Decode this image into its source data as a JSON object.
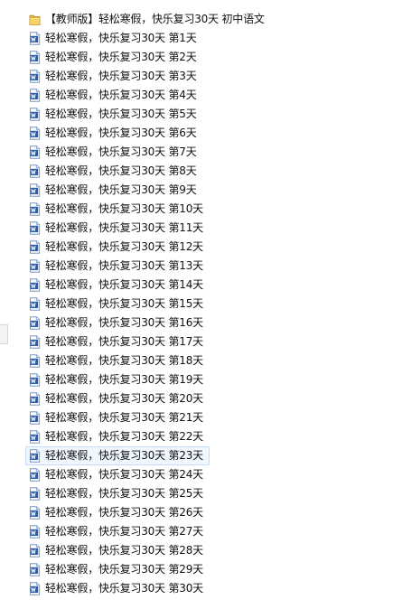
{
  "folder": {
    "name": "【教师版】轻松寒假，快乐复习30天 初中语文",
    "icon": "folder-icon"
  },
  "files": [
    {
      "name": "轻松寒假，快乐复习30天 第1天",
      "icon": "word-document-icon"
    },
    {
      "name": "轻松寒假，快乐复习30天 第2天",
      "icon": "word-document-icon"
    },
    {
      "name": "轻松寒假，快乐复习30天 第3天",
      "icon": "word-document-icon"
    },
    {
      "name": "轻松寒假，快乐复习30天 第4天",
      "icon": "word-document-icon"
    },
    {
      "name": "轻松寒假，快乐复习30天 第5天",
      "icon": "word-document-icon"
    },
    {
      "name": "轻松寒假，快乐复习30天 第6天",
      "icon": "word-document-icon"
    },
    {
      "name": "轻松寒假，快乐复习30天 第7天",
      "icon": "word-document-icon"
    },
    {
      "name": "轻松寒假，快乐复习30天 第8天",
      "icon": "word-document-icon"
    },
    {
      "name": "轻松寒假，快乐复习30天 第9天",
      "icon": "word-document-icon"
    },
    {
      "name": "轻松寒假，快乐复习30天 第10天",
      "icon": "word-document-icon"
    },
    {
      "name": "轻松寒假，快乐复习30天 第11天",
      "icon": "word-document-icon"
    },
    {
      "name": "轻松寒假，快乐复习30天 第12天",
      "icon": "word-document-icon"
    },
    {
      "name": "轻松寒假，快乐复习30天 第13天",
      "icon": "word-document-icon"
    },
    {
      "name": "轻松寒假，快乐复习30天 第14天",
      "icon": "word-document-icon"
    },
    {
      "name": "轻松寒假，快乐复习30天 第15天",
      "icon": "word-document-icon"
    },
    {
      "name": "轻松寒假，快乐复习30天 第16天",
      "icon": "word-document-icon"
    },
    {
      "name": "轻松寒假，快乐复习30天 第17天",
      "icon": "word-document-icon"
    },
    {
      "name": "轻松寒假，快乐复习30天 第18天",
      "icon": "word-document-icon"
    },
    {
      "name": "轻松寒假，快乐复习30天 第19天",
      "icon": "word-document-icon"
    },
    {
      "name": "轻松寒假，快乐复习30天 第20天",
      "icon": "word-document-icon"
    },
    {
      "name": "轻松寒假，快乐复习30天 第21天",
      "icon": "word-document-icon"
    },
    {
      "name": "轻松寒假，快乐复习30天 第22天",
      "icon": "word-document-icon"
    },
    {
      "name": "轻松寒假，快乐复习30天 第23天",
      "icon": "word-document-icon",
      "selected": true
    },
    {
      "name": "轻松寒假，快乐复习30天 第24天",
      "icon": "word-document-icon"
    },
    {
      "name": "轻松寒假，快乐复习30天 第25天",
      "icon": "word-document-icon"
    },
    {
      "name": "轻松寒假，快乐复习30天 第26天",
      "icon": "word-document-icon"
    },
    {
      "name": "轻松寒假，快乐复习30天 第27天",
      "icon": "word-document-icon"
    },
    {
      "name": "轻松寒假，快乐复习30天 第28天",
      "icon": "word-document-icon"
    },
    {
      "name": "轻松寒假，快乐复习30天 第29天",
      "icon": "word-document-icon"
    },
    {
      "name": "轻松寒假，快乐复习30天 第30天",
      "icon": "word-document-icon"
    }
  ],
  "colors": {
    "folder": "#e8b84a",
    "word_blue": "#2a5fb0",
    "selection_fill": "#f1f7ff",
    "selection_border": "#c3dcf7"
  }
}
